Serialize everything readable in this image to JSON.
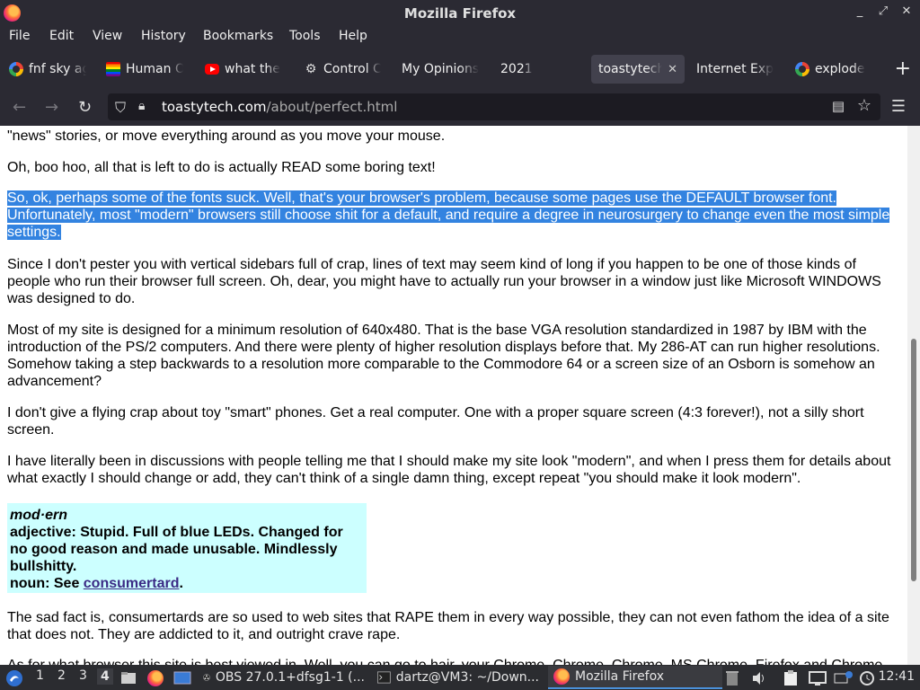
{
  "window": {
    "title": "Mozilla Firefox",
    "controls": [
      "_",
      "⤢",
      "✕"
    ]
  },
  "menu": [
    "File",
    "Edit",
    "View",
    "History",
    "Bookmarks",
    "Tools",
    "Help"
  ],
  "tabs": [
    {
      "label": "fnf sky ag",
      "icon": "google-icon"
    },
    {
      "label": "Human O",
      "icon": "rainbow-icon"
    },
    {
      "label": "what the",
      "icon": "youtube-icon"
    },
    {
      "label": "Control C",
      "icon": "control-icon"
    },
    {
      "label": "My Opinions",
      "icon": ""
    },
    {
      "label": "2021",
      "icon": ""
    },
    {
      "label": "toastytech",
      "icon": "",
      "active": true,
      "close": "✕"
    },
    {
      "label": "Internet Expl",
      "icon": ""
    },
    {
      "label": "explode",
      "icon": "google-icon"
    }
  ],
  "newtab": "+",
  "nav": {
    "back": "←",
    "forward": "→",
    "reload": "↻",
    "menu": "☰"
  },
  "url": {
    "host": "toastytech.com",
    "path": "/about/perfect.html"
  },
  "page": {
    "p0": "\"news\" stories, or move everything around as you move your mouse.",
    "p1": "Oh, boo hoo, all that is left to do is actually READ some boring text!",
    "p2_line1": "So, ok, perhaps some of the fonts suck. Well, that's your browser's problem, because some pages use the DEFAULT browser font.",
    "p2_line2": "Unfortunately, most \"modern\" browsers still choose shit for a default, and require a degree in neurosurgery to change even the most simple",
    "p2_line3": "settings.",
    "p3": "Since I don't pester you with vertical sidebars full of crap, lines of text may seem kind of long if you happen to be one of those kinds of people who run their browser full screen. Oh, dear, you might have to actually run your browser in a window just like Microsoft WINDOWS was designed to do.",
    "p4": "Most of my site is designed for a minimum resolution of 640x480. That is the base VGA resolution standardized in 1987 by IBM with the introduction of the PS/2 computers. And there were plenty of higher resolution displays before that. My 286-AT can run higher resolutions. Somehow taking a step backwards to a resolution more comparable to the Commodore 64 or a screen size of an Osborn is somehow an advancement?",
    "p5": "I don't give a flying crap about toy \"smart\" phones. Get a real computer. One with a proper square screen (4:3 forever!), not a silly short screen.",
    "p6": "I have literally been in discussions with people telling me that I should make my site look \"modern\", and when I press them for details about what exactly I should change or add, they can't think of a single damn thing, except repeat \"you should make it look modern\".",
    "def_word": "mod·ern",
    "def_adj": "adjective: Stupid. Full of blue LEDs. Changed for no good reason and made unusable. Mindlessly bullshitty.",
    "def_noun_prefix": "noun: See ",
    "def_noun_link": "consumertard",
    "def_noun_suffix": ".",
    "p7": "The sad fact is, consumertards are so used to web sites that RAPE them in every way possible, they can not even fathom the idea of a site that does not. They are addicted to it, and outright crave rape.",
    "p8": "As for what browser this site is best viewed in. Well, you can go to hair, your Chrome, Chrome, Chrome, MS Chrome, Firefox and Chrome"
  },
  "taskbar": {
    "workspaces": [
      "1",
      "2",
      "3",
      "4"
    ],
    "active_workspace": "4",
    "windows": [
      {
        "label": "OBS 27.0.1+dfsg1-1 (..."
      },
      {
        "label": "dartz@VM3: ~/Down..."
      },
      {
        "label": "Mozilla Firefox",
        "active": true
      }
    ],
    "clock": "12:41"
  }
}
